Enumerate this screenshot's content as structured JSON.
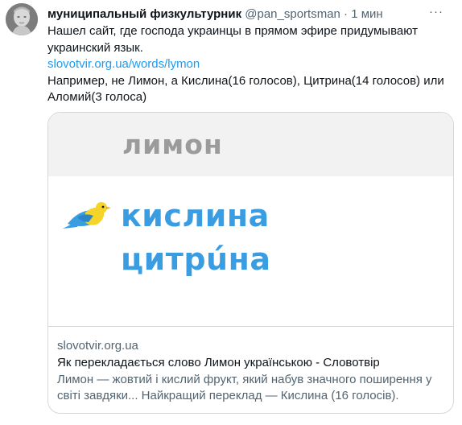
{
  "tweet": {
    "author": {
      "name": "муниципальный физкультурник",
      "handle": "@pan_sportsman",
      "separator": "·",
      "time": "1 мин"
    },
    "more_icon": "more-horizontal-icon",
    "text": {
      "line1": "Нашел сайт, где господа украинцы в прямом эфире придумывают",
      "line2": "украинский язык.",
      "link": "slovotvir.org.ua/words/lymon",
      "line3": "Например, не Лимон, а Кислина(16 голосов), Цитрина(14 голосов) или",
      "line4": "Аломий(3 голоса)"
    },
    "card": {
      "image": {
        "old_word": "лимон",
        "new_word_1": "кислина",
        "new_word_2": "цитрúна",
        "word_color": "#3b9de1",
        "old_word_color": "#9b9b9b",
        "bird_colors": {
          "blue": "#3b9de1",
          "yellow": "#f5d327"
        }
      },
      "domain": "slovotvir.org.ua",
      "title": "Як перекладається слово Лимон українською - Словотвір",
      "description_line1": "Лимон — жовтий і кислий фрукт, який набув значного поширення у",
      "description_line2": "світі завдяки... Найкращий переклад — Кислина (16 голосів)."
    }
  }
}
